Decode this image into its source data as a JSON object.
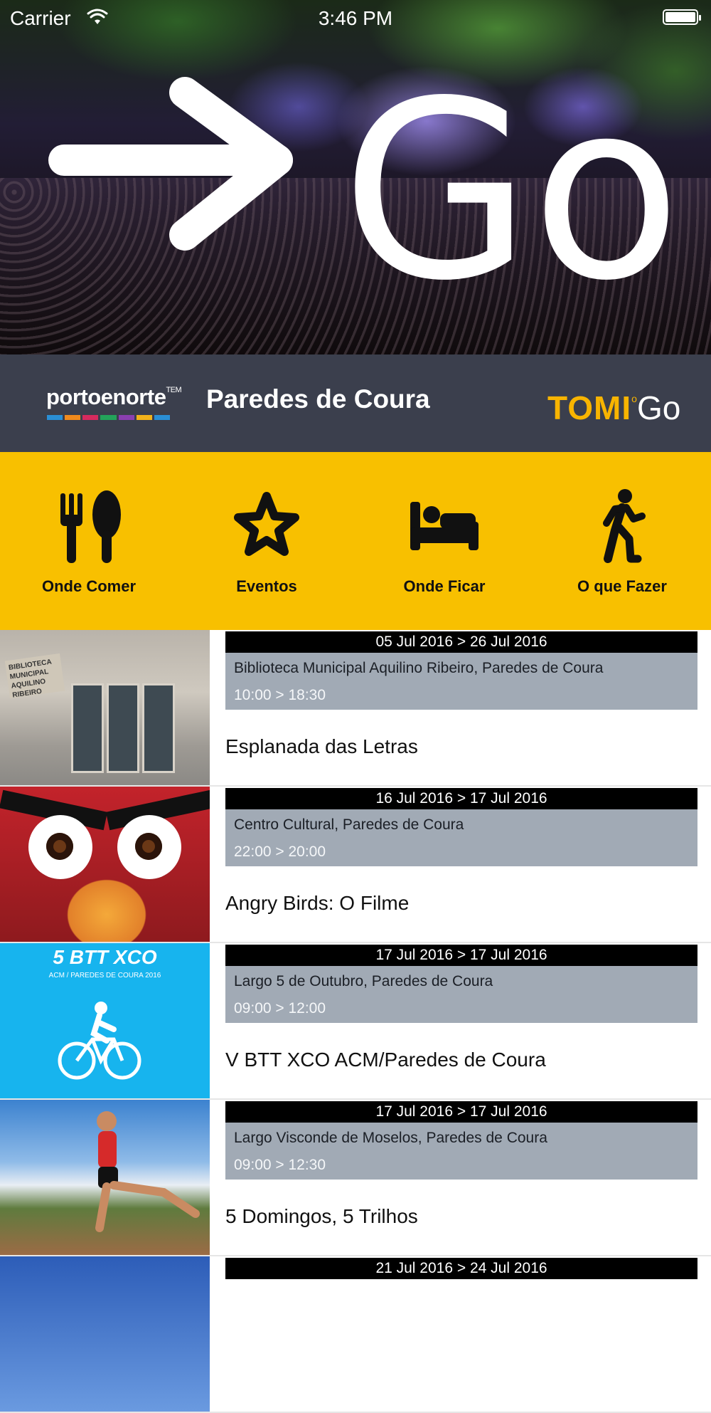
{
  "status_bar": {
    "carrier": "Carrier",
    "time": "3:46 PM"
  },
  "hero": {
    "logo_text": "Go"
  },
  "brand": {
    "porto": "portoenorte",
    "porto_tm": "TEM",
    "porto_stripe_colors": [
      "#2a8fd6",
      "#f08a1c",
      "#d62a5e",
      "#23a35a",
      "#8a3fb0",
      "#f2b21b",
      "#2a8fd6"
    ],
    "town": "Paredes de Coura",
    "tomi": "TOMI",
    "tomi_go": "Go"
  },
  "categories": [
    {
      "label": "Onde Comer",
      "icon": "fork-spoon-icon"
    },
    {
      "label": "Eventos",
      "icon": "star-icon"
    },
    {
      "label": "Onde Ficar",
      "icon": "bed-icon"
    },
    {
      "label": "O que Fazer",
      "icon": "walker-icon"
    }
  ],
  "events": [
    {
      "dates": "05 Jul 2016 > 26 Jul 2016",
      "place": "Biblioteca Municipal Aquilino Ribeiro, Paredes de Coura",
      "time": "10:00 > 18:30",
      "title": "Esplanada das Letras"
    },
    {
      "dates": "16 Jul 2016 > 17 Jul 2016",
      "place": "Centro Cultural, Paredes de Coura",
      "time": "22:00 > 20:00",
      "title": "Angry Birds: O Filme"
    },
    {
      "dates": "17 Jul 2016 > 17 Jul 2016",
      "place": "Largo 5 de Outubro, Paredes de Coura",
      "time": "09:00 > 12:00",
      "title": "V BTT XCO ACM/Paredes de Coura"
    },
    {
      "dates": "17 Jul 2016 > 17 Jul 2016",
      "place": "Largo Visconde de Moselos, Paredes de Coura",
      "time": "09:00 > 12:30",
      "title": "5 Domingos, 5 Trilhos"
    },
    {
      "dates": "21 Jul 2016 > 24 Jul 2016"
    }
  ],
  "thumbnails": {
    "library_sign": "BIBLIOTECA MUNICIPAL AQUILINO RIBEIRO",
    "bike_header": "5 BTT XCO",
    "bike_sub": "ACM / PAREDES DE COURA 2016"
  },
  "colors": {
    "accent_yellow": "#f8c000",
    "brand_bar": "#3b3f4d",
    "info_gray": "#a1aab5",
    "tomi_gold": "#f8b400"
  }
}
